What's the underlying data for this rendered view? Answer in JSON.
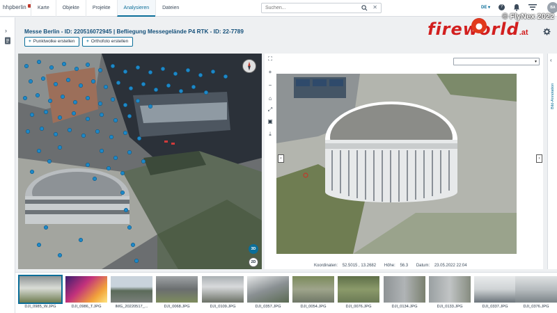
{
  "app": {
    "logo": "hhpberlin"
  },
  "nav": {
    "tabs": [
      "Karte",
      "Objekte",
      "Projekte",
      "Analysieren",
      "Dateien"
    ],
    "active_index": 3
  },
  "search": {
    "placeholder": "Suchen...",
    "value": ""
  },
  "header_right": {
    "language": "DE",
    "user_initials": "BA"
  },
  "watermark": {
    "credit": "© FlyNex 2022",
    "brand": "fireworld",
    "brand_suffix": ".at"
  },
  "page": {
    "title": "Messe Berlin - ID: 220516072945 | Befliegung Messegelände P4 RTK - ID: 22-7789",
    "buttons": [
      "Punktwolke erstellen",
      "Orthofoto erstellen"
    ]
  },
  "viewer3d": {
    "mode_3d": "3D",
    "mode_2d": "2D"
  },
  "image_viewer": {
    "dropdown_value": "",
    "side_label": "Bild-Annotation",
    "coordinates_label": "Koordinaten:",
    "coordinates_value": "52.5015 , 13.2682",
    "height_label": "Höhe:",
    "height_value": "56.3",
    "date_label": "Datum:",
    "date_value": "23.05.2022 22:04"
  },
  "thumbnails": [
    "DJI_0985_W.JPG",
    "DJI_0986_T.JPG",
    "IMG_20220517_...",
    "DJI_0068.JPG",
    "DJI_0109.JPG",
    "DJI_0357.JPG",
    "DJI_0054.JPG",
    "DJI_0076.JPG",
    "DJI_0134.JPG",
    "DJI_0133.JPG",
    "DJI_0337.JPG",
    "DJI_0376.JPG"
  ],
  "colors": {
    "accent": "#0b6e99",
    "title": "#14507a",
    "brand_red": "#d21f1f"
  }
}
